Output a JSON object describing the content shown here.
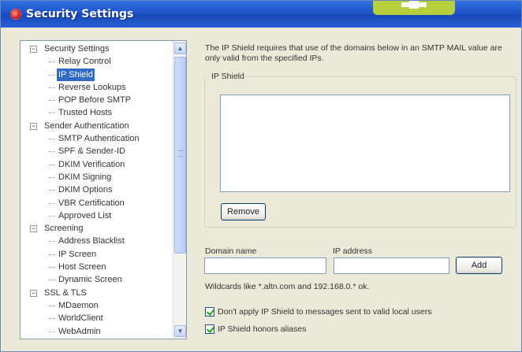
{
  "window": {
    "title": "Security Settings"
  },
  "tree": {
    "items": [
      {
        "label": "Security Settings",
        "level": 0,
        "expander": "⊟"
      },
      {
        "label": "Relay Control",
        "level": 1
      },
      {
        "label": "IP Shield",
        "level": 1,
        "selected": true
      },
      {
        "label": "Reverse Lookups",
        "level": 1
      },
      {
        "label": "POP Before SMTP",
        "level": 1
      },
      {
        "label": "Trusted Hosts",
        "level": 1
      },
      {
        "label": "Sender Authentication",
        "level": 0,
        "expander": "⊟"
      },
      {
        "label": "SMTP Authentication",
        "level": 1
      },
      {
        "label": "SPF & Sender-ID",
        "level": 1
      },
      {
        "label": "DKIM Verification",
        "level": 1
      },
      {
        "label": "DKIM Signing",
        "level": 1
      },
      {
        "label": "DKIM Options",
        "level": 1
      },
      {
        "label": "VBR Certification",
        "level": 1
      },
      {
        "label": "Approved List",
        "level": 1
      },
      {
        "label": "Screening",
        "level": 0,
        "expander": "⊟"
      },
      {
        "label": "Address Blacklist",
        "level": 1
      },
      {
        "label": "IP Screen",
        "level": 1
      },
      {
        "label": "Host Screen",
        "level": 1
      },
      {
        "label": "Dynamic Screen",
        "level": 1
      },
      {
        "label": "SSL & TLS",
        "level": 0,
        "expander": "⊟"
      },
      {
        "label": "MDaemon",
        "level": 1
      },
      {
        "label": "WorldClient",
        "level": 1
      },
      {
        "label": "WebAdmin",
        "level": 1
      }
    ]
  },
  "ip_shield": {
    "description": "The IP Shield requires that use of the domains below in an SMTP MAIL value are only valid from the specified IPs.",
    "group_title": "IP Shield",
    "remove_label": "Remove",
    "domain_label": "Domain name",
    "ip_label": "IP address",
    "domain_value": "",
    "ip_value": "",
    "add_label": "Add",
    "hint": "Wildcards like *.altn.com and 192.168.0.* ok.",
    "option_dont_apply": "Don't apply IP Shield to messages sent to valid local users",
    "option_honors_aliases": "IP Shield honors aliases"
  },
  "colors": {
    "title_bar": "#1f55c8",
    "selection": "#316ac5",
    "badge": "#b7cf3c",
    "check_mark": "#21a121"
  },
  "icons": {
    "window": "app-shield-icon",
    "expander": "tree-collapse-icon",
    "scroll_up": "scroll-up-arrow-icon",
    "scroll_down": "scroll-down-arrow-icon"
  }
}
